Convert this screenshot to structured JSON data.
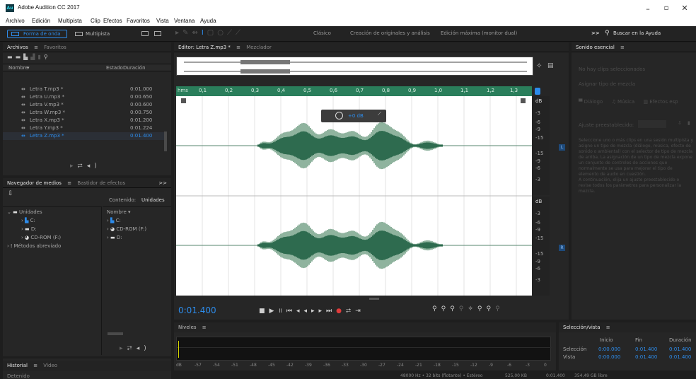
{
  "app": {
    "title": "Adobe Audition CC 2017",
    "icon": "Au"
  },
  "menu": [
    "Archivo",
    "Edición",
    "Multipista",
    "Clip",
    "Efectos",
    "Favoritos",
    "Vista",
    "Ventana",
    "Ayuda"
  ],
  "modes": {
    "waveform": "Forma de onda",
    "multitrack": "Multipista"
  },
  "workspaces": [
    "Clásico",
    "Creación de originales y análisis",
    "Edición máxima (monitor dual)"
  ],
  "search": {
    "chevrons": ">>",
    "label": "Buscar en la Ayuda"
  },
  "files": {
    "tabs": [
      "Archivos",
      "Favoritos"
    ],
    "col_name": "Nombre",
    "col_state": "Estado",
    "col_duration": "Duración",
    "rows": [
      {
        "name": "Letra T.mp3 *",
        "duration": "0:01.000"
      },
      {
        "name": "Letra U.mp3 *",
        "duration": "0:00.650"
      },
      {
        "name": "Letra V.mp3 *",
        "duration": "0:00.600"
      },
      {
        "name": "Letra W.mp3 *",
        "duration": "0:00.750"
      },
      {
        "name": "Letra X.mp3 *",
        "duration": "0:01.200"
      },
      {
        "name": "Letra Y.mp3 *",
        "duration": "0:01.224"
      },
      {
        "name": "Letra Z.mp3 *",
        "duration": "0:01.400"
      }
    ],
    "selected_index": 6
  },
  "media": {
    "tabs": [
      "Navegador de medios",
      "Bastidor de efectos"
    ],
    "chevrons": ">>",
    "content_label": "Contenido:",
    "units_label": "Unidades",
    "tree": [
      {
        "label": "Unidades",
        "expanded": true
      },
      {
        "label": "C:"
      },
      {
        "label": "D:"
      },
      {
        "label": "CD-ROM (F:)"
      },
      {
        "label": "Métodos abreviado"
      }
    ],
    "col_name": "Nombre",
    "list": [
      {
        "label": "C:"
      },
      {
        "label": "CD-ROM (F:)"
      },
      {
        "label": "D:"
      }
    ]
  },
  "history": {
    "tabs": [
      "Historial",
      "Vídeo"
    ],
    "status": "Detenido"
  },
  "editor": {
    "tab": "Editor: Letra Z.mp3 *",
    "mixer_tab": "Mezclador",
    "ruler": {
      "start": "hms",
      "ticks": [
        "0,1",
        "0,2",
        "0,3",
        "0,4",
        "0,5",
        "0,6",
        "0,7",
        "0,8",
        "0,9",
        "1,0",
        "1,1",
        "1,2",
        "1,3"
      ]
    },
    "hud": {
      "db": "+0 dB"
    },
    "db_scale": {
      "label": "dB",
      "marks": [
        "-3",
        "-6",
        "-9",
        "-15",
        "-15",
        "-9",
        "-6",
        "-3"
      ],
      "center": "L"
    },
    "db_scale_r": {
      "label": "dB",
      "marks": [
        "-3",
        "-6",
        "-9",
        "-15",
        "-15",
        "-9",
        "-6",
        "-3"
      ],
      "center": "R"
    },
    "time": "0:01.400"
  },
  "levels": {
    "title": "Niveles",
    "marks": [
      "dB",
      "-57",
      "-54",
      "-51",
      "-48",
      "-45",
      "-42",
      "-39",
      "-36",
      "-33",
      "-30",
      "-27",
      "-24",
      "-21",
      "-18",
      "-15",
      "-12",
      "-9",
      "-6",
      "-3",
      "0"
    ]
  },
  "essential": {
    "title": "Sonido esencial",
    "no_clips": "No hay clips seleccionados",
    "assign": "Asignar tipo de mezcla",
    "types": [
      "Diálogo",
      "Música",
      "Efectos esp"
    ],
    "preset": "Ajuste preestablecido:",
    "help": "Seleccione uno o más clips en una sesión multipista y asigne un tipo de mezcla (diálogo, música, efecto de sonido o ambiental) con el selector de tipo de mezcla de arriba. La asignación de un tipo de mezcla expone un conjunto de controles de acciones que normalmente se usa para mejorar el tipo de elemento de audio en cuestión.\nA continuación, elija un ajuste preestablecido o revise todos los parámetros para personalizar la mezcla."
  },
  "selection": {
    "title": "Selección/vista",
    "cols": [
      "Inicio",
      "Fin",
      "Duración"
    ],
    "rows": [
      {
        "label": "Selección",
        "vals": [
          "0:00.000",
          "0:01.400",
          "0:01.400"
        ]
      },
      {
        "label": "Vista",
        "vals": [
          "0:00.000",
          "0:01.400",
          "0:01.400"
        ]
      }
    ]
  },
  "status": {
    "text": "48000 Hz • 32 bits (flotante) • Estéreo",
    "size": "525,00 KB",
    "dur": "0:01.400",
    "free": "354,49 GB libre"
  },
  "colors": {
    "accent": "#2d8ceb",
    "wave": "#2e6b4f",
    "wave_light": "#8fb39e",
    "ruler": "#2a7e5b"
  }
}
